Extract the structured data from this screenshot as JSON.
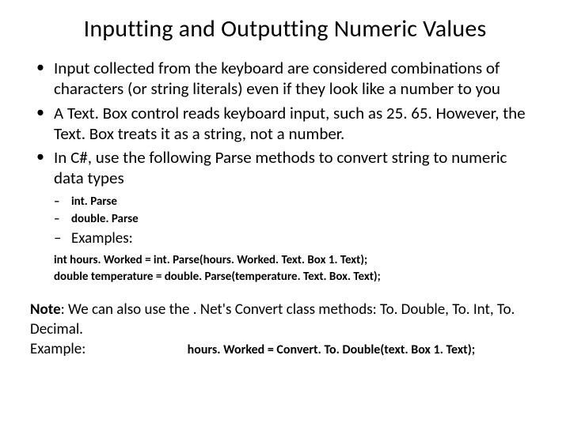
{
  "title": "Inputting and Outputting Numeric Values",
  "bullets": {
    "b1": "Input collected from the keyboard are considered combinations of characters (or string literals) even if they look like a number to you",
    "b2": "A Text. Box control reads keyboard input, such as 25. 65. However, the Text. Box treats it as a string, not a number.",
    "b3": "In C#, use the following Parse methods to convert string to numeric data types"
  },
  "sub": {
    "s1": "int. Parse",
    "s2": "double. Parse",
    "s3": "Examples:"
  },
  "code": {
    "c1": "int hours. Worked = int. Parse(hours. Worked. Text. Box 1. Text);",
    "c2": "double temperature = double. Parse(temperature. Text. Box. Text);"
  },
  "note": {
    "label": "Note",
    "text": ": We can also use the . Net's Convert class methods: To. Double, To. Int, To. Decimal.",
    "example_label": "Example:",
    "example_code": "hours. Worked = Convert. To. Double(text. Box 1. Text);"
  }
}
